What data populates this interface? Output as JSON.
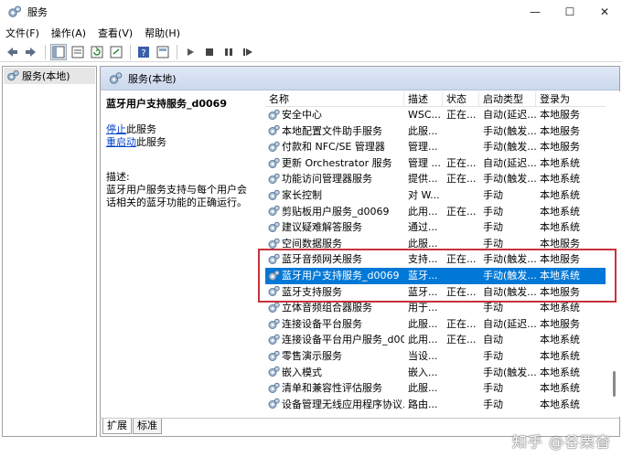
{
  "window": {
    "title": "服务",
    "controls": [
      "—",
      "☐",
      "✕"
    ]
  },
  "menu": [
    "文件(F)",
    "操作(A)",
    "查看(V)",
    "帮助(H)"
  ],
  "toolbar": [
    "back-arrow-icon",
    "forward-arrow-icon",
    "console-tree-icon",
    "properties-icon",
    "refresh-icon",
    "export-icon",
    "help-icon",
    "view-icon",
    "play-icon",
    "stop-icon",
    "pause-icon",
    "restart-icon"
  ],
  "tree": {
    "item": "服务(本地)"
  },
  "pane": {
    "header": "服务(本地)"
  },
  "details": {
    "title": "蓝牙用户支持服务_d0069",
    "stop_link": "停止",
    "stop_suffix": "此服务",
    "restart_link": "重启动",
    "restart_suffix": "此服务",
    "desc_label": "描述:",
    "desc_text": "蓝牙用户服务支持与每个用户会话相关的蓝牙功能的正确运行。"
  },
  "columns": {
    "name": "名称",
    "desc": "描述",
    "status": "状态",
    "start": "启动类型",
    "logon": "登录为"
  },
  "services": [
    {
      "name": "安全中心",
      "desc": "WSC...",
      "status": "正在...",
      "start": "自动(延迟...",
      "logon": "本地服务"
    },
    {
      "name": "本地配置文件助手服务",
      "desc": "此服...",
      "status": "",
      "start": "手动(触发...",
      "logon": "本地服务"
    },
    {
      "name": "付款和 NFC/SE 管理器",
      "desc": "管理...",
      "status": "",
      "start": "手动(触发...",
      "logon": "本地服务"
    },
    {
      "name": "更新 Orchestrator 服务",
      "desc": "管理 ...",
      "status": "正在...",
      "start": "自动(延迟...",
      "logon": "本地系统"
    },
    {
      "name": "功能访问管理器服务",
      "desc": "提供...",
      "status": "正在...",
      "start": "手动(触发...",
      "logon": "本地系统"
    },
    {
      "name": "家长控制",
      "desc": "对 W...",
      "status": "",
      "start": "手动",
      "logon": "本地系统"
    },
    {
      "name": "剪贴板用户服务_d0069",
      "desc": "此用...",
      "status": "正在...",
      "start": "手动",
      "logon": "本地系统"
    },
    {
      "name": "建议疑难解答服务",
      "desc": "通过...",
      "status": "",
      "start": "手动",
      "logon": "本地系统"
    },
    {
      "name": "空间数据服务",
      "desc": "此服...",
      "status": "",
      "start": "手动",
      "logon": "本地服务"
    },
    {
      "name": "蓝牙音频网关服务",
      "desc": "支持...",
      "status": "正在...",
      "start": "手动(触发...",
      "logon": "本地服务"
    },
    {
      "name": "蓝牙用户支持服务_d0069",
      "desc": "蓝牙...",
      "status": "",
      "start": "手动(触发...",
      "logon": "本地系统"
    },
    {
      "name": "蓝牙支持服务",
      "desc": "蓝牙...",
      "status": "正在...",
      "start": "自动(触发...",
      "logon": "本地服务"
    },
    {
      "name": "立体音频组合器服务",
      "desc": "用于...",
      "status": "",
      "start": "手动",
      "logon": "本地系统"
    },
    {
      "name": "连接设备平台服务",
      "desc": "此服...",
      "status": "正在...",
      "start": "自动(延迟...",
      "logon": "本地服务"
    },
    {
      "name": "连接设备平台用户服务_d00...",
      "desc": "此用...",
      "status": "正在...",
      "start": "自动",
      "logon": "本地系统"
    },
    {
      "name": "零售演示服务",
      "desc": "当设...",
      "status": "",
      "start": "手动",
      "logon": "本地系统"
    },
    {
      "name": "嵌入模式",
      "desc": "嵌入...",
      "status": "",
      "start": "手动(触发...",
      "logon": "本地系统"
    },
    {
      "name": "清单和兼容性评估服务",
      "desc": "此服...",
      "status": "",
      "start": "手动",
      "logon": "本地系统"
    },
    {
      "name": "设备管理无线应用程序协议...",
      "desc": "路由...",
      "status": "",
      "start": "手动",
      "logon": "本地系统"
    }
  ],
  "selected_row": 10,
  "tabs": [
    "扩展",
    "标准"
  ],
  "watermark": "知乎 @谷栗杳",
  "colors": {
    "selection": "#0078d7",
    "highlight_box": "#c8323c",
    "link": "#0645c8"
  }
}
